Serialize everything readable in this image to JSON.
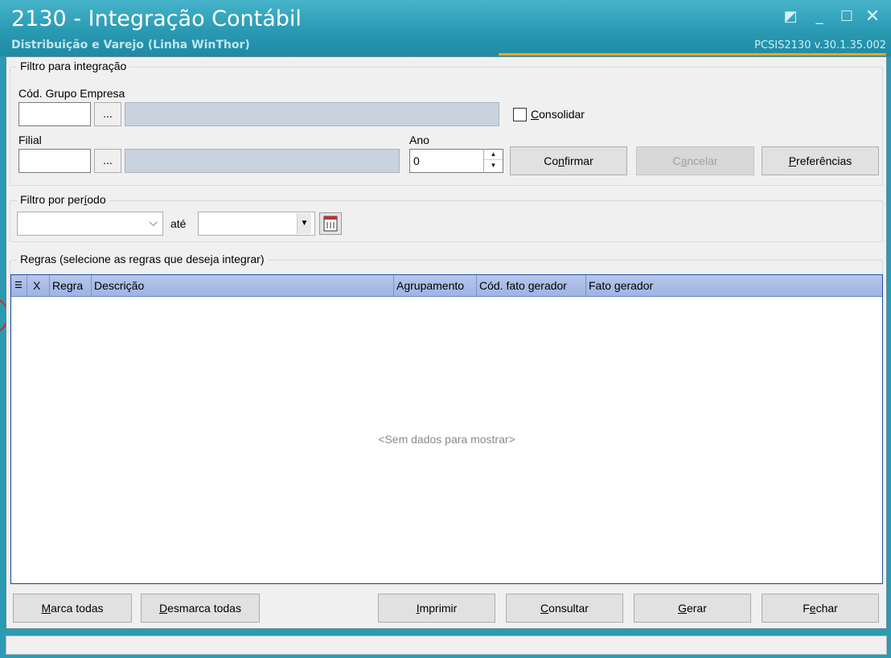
{
  "window": {
    "title": "2130 - Integração Contábil",
    "subtitle": "Distribuição e Varejo (Linha WinThor)",
    "version": "PCSIS2130  v.30.1.35.002",
    "accent_color": "#f5a623",
    "controls": [
      "restore-icon",
      "minimize-icon",
      "maximize-icon",
      "close-icon"
    ]
  },
  "filtro_integracao": {
    "caption": "Filtro para integração",
    "grupo_empresa_label": "Cód. Grupo Empresa",
    "grupo_empresa_value": "",
    "grupo_empresa_desc": "",
    "dots_label": "...",
    "consolidar_label": "Consolidar",
    "consolidar_checked": false,
    "filial_label": "Filial",
    "filial_value": "",
    "filial_desc": "",
    "ano_label": "Ano",
    "ano_value": "0",
    "confirmar_label": "Confirmar",
    "cancelar_label": "Cancelar",
    "preferencias_label": "Preferências"
  },
  "filtro_periodo": {
    "caption": "Filtro por período",
    "de_value": "",
    "ate_label": "até",
    "ate_value": ""
  },
  "regras": {
    "caption": "Regras (selecione as regras que deseja integrar)",
    "columns": [
      "X",
      "Regra",
      "Descrição",
      "Agrupamento",
      "Cód. fato gerador",
      "Fato gerador"
    ],
    "rows": [],
    "empty_message": "<Sem dados para mostrar>"
  },
  "footer_buttons": {
    "marca_todas": "Marca todas",
    "desmarca_todas": "Desmarca todas",
    "imprimir": "Imprimir",
    "consultar": "Consultar",
    "gerar": "Gerar",
    "fechar": "Fechar"
  },
  "status_bar": {
    "text": ""
  }
}
